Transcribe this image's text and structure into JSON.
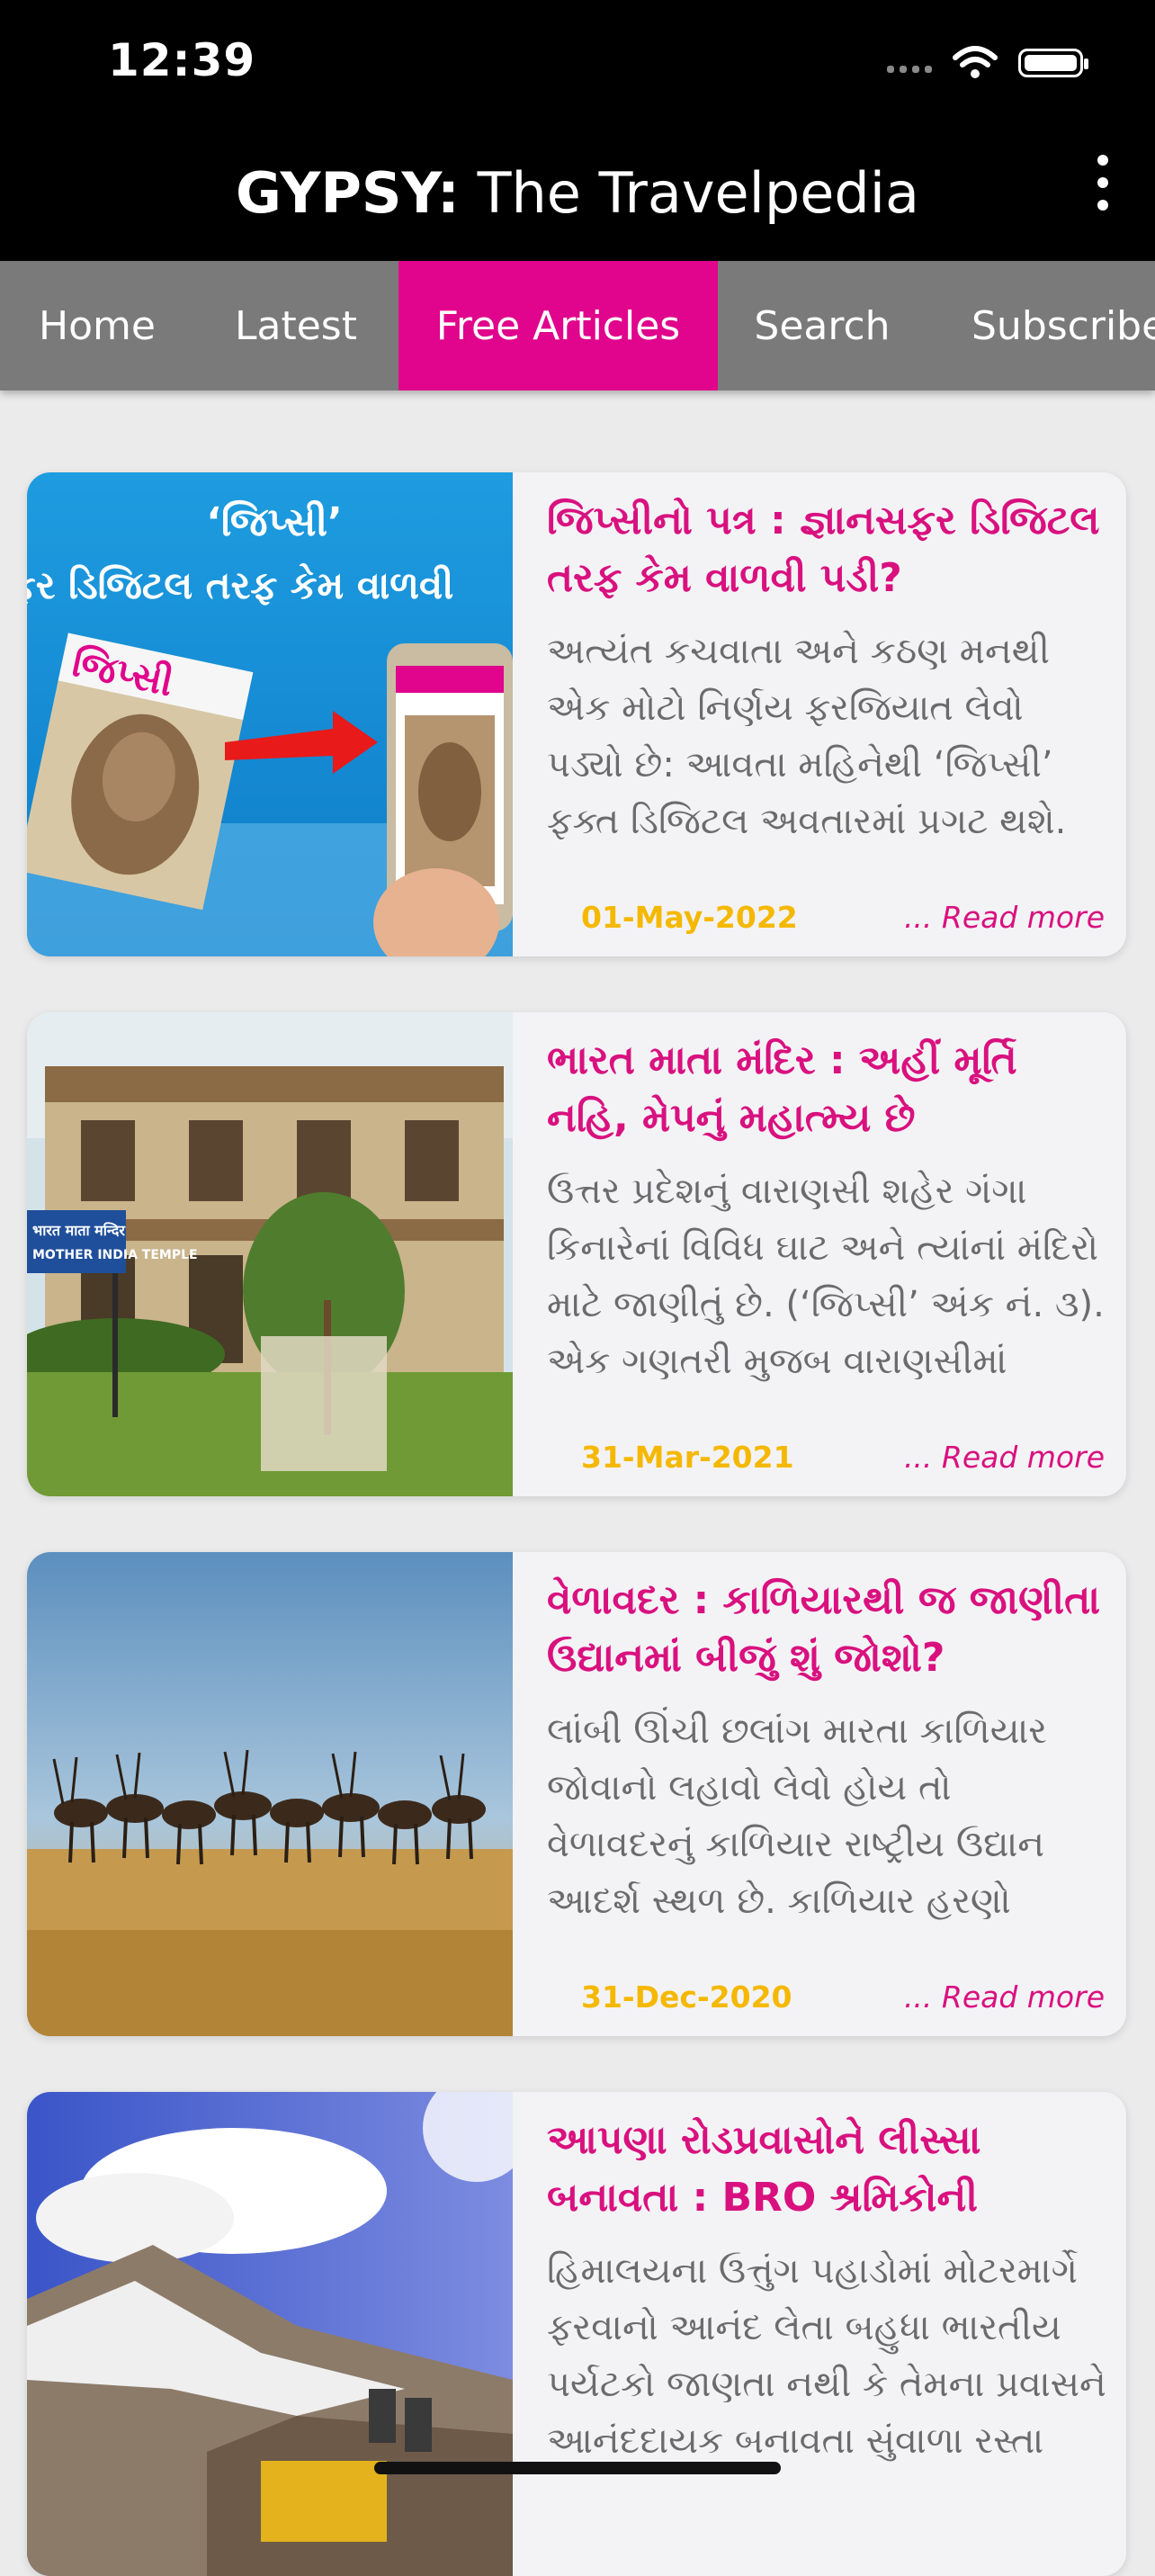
{
  "status_bar": {
    "time": "12:39",
    "icons": [
      "signal-icon",
      "wifi-icon",
      "battery-icon"
    ]
  },
  "header": {
    "title_bold": "GYPSY:",
    "title_rest": " The Travelpedia",
    "menu_icon": "more-vertical-icon"
  },
  "tabs": [
    {
      "label": "Home"
    },
    {
      "label": "Latest"
    },
    {
      "label": "Free Articles",
      "active": true
    },
    {
      "label": "Search"
    },
    {
      "label": "Subscribe"
    }
  ],
  "colors": {
    "accent": "#e0058c",
    "title": "#d9117f",
    "date": "#f5b800",
    "header_bg": "#000000",
    "tabbar_bg": "#7a7a7a"
  },
  "articles": [
    {
      "title": "જિપ્સીનો પત્ર : જ્ઞાનસફર ડિજિટલ તરફ કેમ વાળવી પડી?",
      "excerpt": "અત્યંત કચવાતા અને કઠણ મનથી એક મોટો નિર્ણય ફરજિયાત લેવો પડ્યો છે: આવતા મહિનેથી ‘જિપ્સી’ ફક્ત ડિજિટલ અવતારમાં પ્રગટ થશે. મુદ્રિત",
      "date": "01-May-2022",
      "read_more": "... Read more",
      "image": {
        "type": "promo",
        "line1": "‘જિપ્સી’",
        "line2": "સફર ડિજિટલ તરફ કેમ વાળવી",
        "magazine_title": "જિપ્સી"
      }
    },
    {
      "title": "ભારત માતા મંદિર : અહીં મૂર્તિ નહિ, મેપનું મહાત્મ્ય છે",
      "excerpt": "ઉત્તર પ્રદેશનું વારાણસી શહેર ગંગા કિનારેનાં વિવિધ ઘાટ અને ત્યાંનાં મંદિરો માટે જાણીતું છે. (‘જિપ્સી’ અંક નં. ૩). એક ગણતરી મુજબ વારાણસીમાં",
      "date": "31-Mar-2021",
      "read_more": "... Read more",
      "image": {
        "type": "building",
        "sign_line1": "भारत माता मन्दिर",
        "sign_line2": "MOTHER INDIA TEMPLE"
      }
    },
    {
      "title": "વેળાવદર : કાળિયારથી જ જાણીતા ઉદ્યાનમાં બીજું શું જોશો?",
      "excerpt": "લાંબી ઊંચી છલાંગ મારતા કાળિયાર જોવાનો લહાવો લેવો હોય તો વેળાવદરનું કાળિયાર રાષ્ટ્રીય ઉદ્યાન આદર્શ સ્થળ છે. કાળિયાર હરણો",
      "date": "31-Dec-2020",
      "read_more": "... Read more",
      "image": {
        "type": "blackbuck"
      }
    },
    {
      "title": "આપણા રોડપ્રવાસોને લીસ્સા બનાવતા : BRO શ્રમિકોની ખરબચ...",
      "excerpt": "હિમાલયના ઉત્તુંગ પહાડોમાં મોટરમાર્ગે ફરવાનો આનંદ લેતા બહુધા ભારતીય પર્યટકો જાણતા નથી કે તેમના પ્રવાસને આનંદદાયક બનાવતા સુંવાળા રસ્તા",
      "date": "",
      "read_more": "",
      "image": {
        "type": "mountain"
      }
    }
  ]
}
